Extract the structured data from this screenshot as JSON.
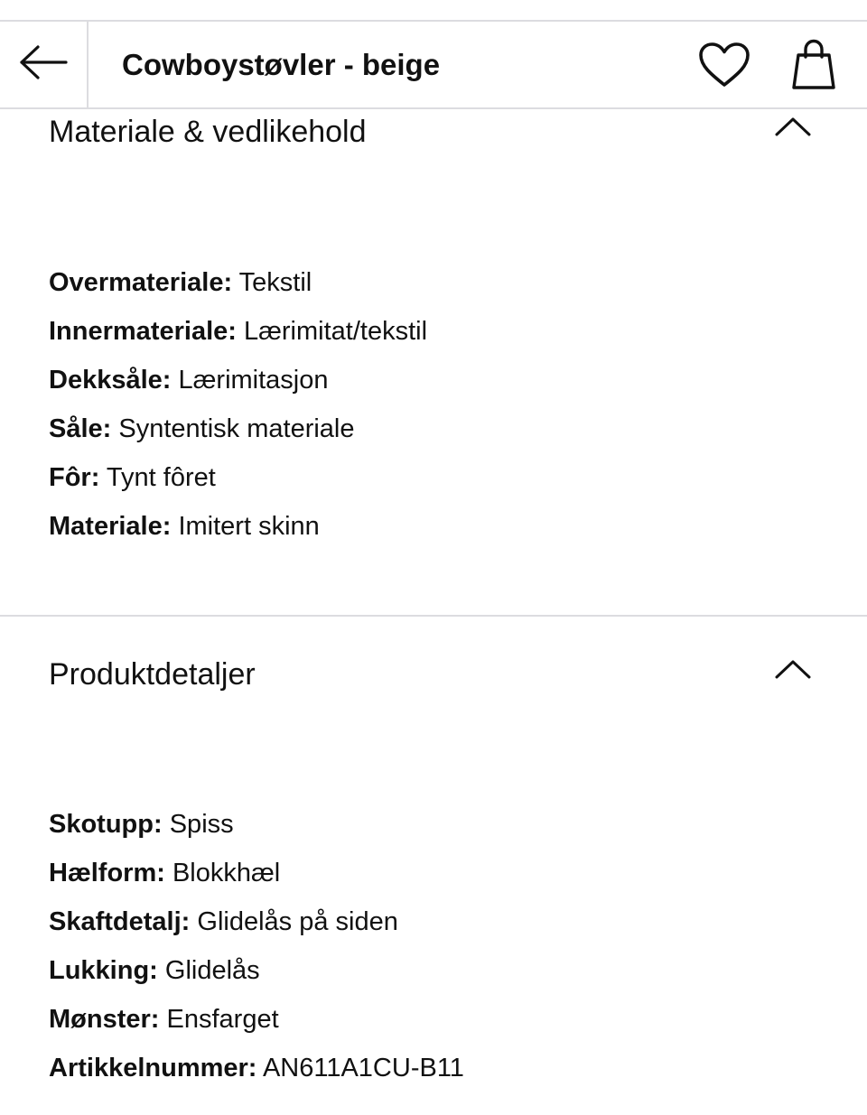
{
  "header": {
    "title": "Cowboystøvler - beige",
    "back_icon": "arrow-left-icon",
    "wishlist_icon": "heart-icon",
    "bag_icon": "shopping-bag-icon"
  },
  "sections": [
    {
      "title": "Materiale & vedlikehold",
      "expanded": true,
      "items": [
        {
          "key": "Overmateriale:",
          "value": "Tekstil"
        },
        {
          "key": "Innermateriale:",
          "value": "Lærimitat/tekstil"
        },
        {
          "key": "Dekksåle:",
          "value": "Lærimitasjon"
        },
        {
          "key": "Såle:",
          "value": "Syntentisk materiale"
        },
        {
          "key": "Fôr:",
          "value": "Tynt fôret"
        },
        {
          "key": "Materiale:",
          "value": "Imitert skinn"
        }
      ]
    },
    {
      "title": "Produktdetaljer",
      "expanded": true,
      "items": [
        {
          "key": "Skotupp:",
          "value": "Spiss"
        },
        {
          "key": "Hælform:",
          "value": "Blokkhæl"
        },
        {
          "key": "Skaftdetalj:",
          "value": "Glidelås på siden"
        },
        {
          "key": "Lukking:",
          "value": "Glidelås"
        },
        {
          "key": "Mønster:",
          "value": "Ensfarget"
        },
        {
          "key": "Artikkelnummer:",
          "value": "AN611A1CU-B11"
        }
      ]
    }
  ],
  "colors": {
    "text": "#111111",
    "divider": "#dcdce0",
    "background": "#ffffff"
  }
}
